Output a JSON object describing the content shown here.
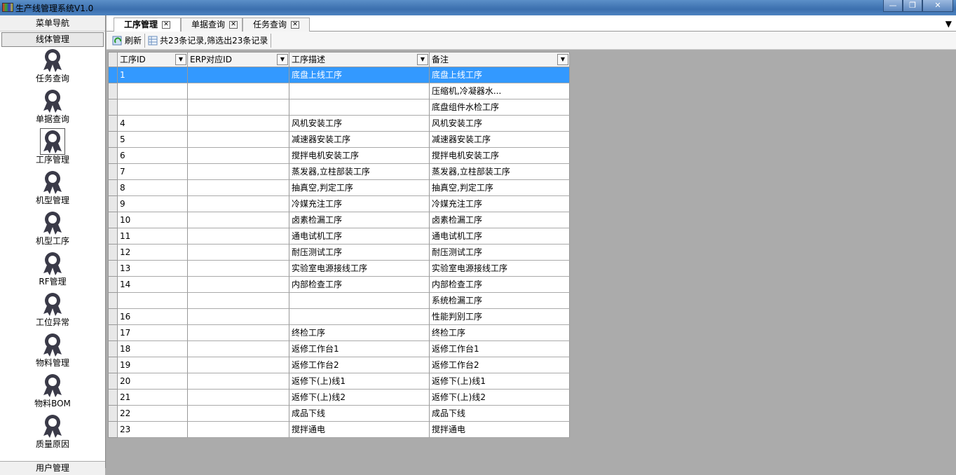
{
  "window": {
    "title": "生产线管理系统V1.0",
    "min": "—",
    "max": "❐",
    "close": "✕"
  },
  "sidebar": {
    "header": "菜单导航",
    "group": "线体管理",
    "items": [
      "任务查询",
      "单据查询",
      "工序管理",
      "机型管理",
      "机型工序",
      "RF管理",
      "工位异常",
      "物料管理",
      "物料BOM",
      "质量原因"
    ],
    "selected": 2,
    "footer": "用户管理"
  },
  "tabs": [
    {
      "label": "工序管理",
      "close": "✕"
    },
    {
      "label": "单据查询",
      "close": "✕"
    },
    {
      "label": "任务查询",
      "close": "✕"
    }
  ],
  "tab_menu": "▼",
  "toolbar": {
    "refresh": "刷新",
    "summary": "共23条记录,筛选出23条记录"
  },
  "grid": {
    "columns": [
      "工序ID",
      "ERP对应ID",
      "工序描述",
      "备注"
    ],
    "dropdown": "▼",
    "rows": [
      [
        "1",
        "",
        "底盘上线工序",
        "底盘上线工序"
      ],
      [
        "",
        "",
        "",
        "压缩机,冷凝器水..."
      ],
      [
        "",
        "",
        "",
        "底盘组件水检工序"
      ],
      [
        "4",
        "",
        "风机安装工序",
        "风机安装工序"
      ],
      [
        "5",
        "",
        "减速器安装工序",
        "减速器安装工序"
      ],
      [
        "6",
        "",
        "搅拌电机安装工序",
        "搅拌电机安装工序"
      ],
      [
        "7",
        "",
        "蒸发器,立柱部装工序",
        "蒸发器,立柱部装工序"
      ],
      [
        "8",
        "",
        "抽真空,判定工序",
        "抽真空,判定工序"
      ],
      [
        "9",
        "",
        "冷媒充注工序",
        "冷媒充注工序"
      ],
      [
        "10",
        "",
        "卤素检漏工序",
        "卤素检漏工序"
      ],
      [
        "11",
        "",
        "通电试机工序",
        "通电试机工序"
      ],
      [
        "12",
        "",
        "耐压测试工序",
        "耐压测试工序"
      ],
      [
        "13",
        "",
        "实验室电源接线工序",
        "实验室电源接线工序"
      ],
      [
        "14",
        "",
        "内部检查工序",
        "内部检查工序"
      ],
      [
        "",
        "",
        "",
        "系统检漏工序"
      ],
      [
        "16",
        "",
        "",
        "性能判别工序"
      ],
      [
        "17",
        "",
        "终检工序",
        "终检工序"
      ],
      [
        "18",
        "",
        "返修工作台1",
        "返修工作台1"
      ],
      [
        "19",
        "",
        "返修工作台2",
        "返修工作台2"
      ],
      [
        "20",
        "",
        "返修下(上)线1",
        "返修下(上)线1"
      ],
      [
        "21",
        "",
        "返修下(上)线2",
        "返修下(上)线2"
      ],
      [
        "22",
        "",
        "成品下线",
        "成品下线"
      ],
      [
        "23",
        "",
        "搅拌通电",
        "搅拌通电"
      ]
    ],
    "selected_row": 0
  }
}
